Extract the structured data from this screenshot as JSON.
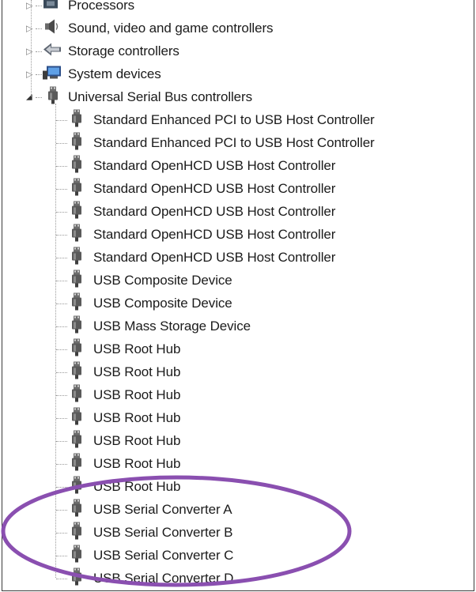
{
  "tree": {
    "categories": [
      {
        "label": "Processors",
        "icon": "processor-icon",
        "expanded": false
      },
      {
        "label": "Sound, video and game controllers",
        "icon": "speaker-icon",
        "expanded": false
      },
      {
        "label": "Storage controllers",
        "icon": "storage-controller-icon",
        "expanded": false
      },
      {
        "label": "System devices",
        "icon": "system-devices-icon",
        "expanded": false
      },
      {
        "label": "Universal Serial Bus controllers",
        "icon": "usb-plug-icon",
        "expanded": true
      }
    ],
    "usb_children": [
      {
        "label": "Standard Enhanced PCI to USB Host Controller",
        "icon": "usb-plug-icon"
      },
      {
        "label": "Standard Enhanced PCI to USB Host Controller",
        "icon": "usb-plug-icon"
      },
      {
        "label": "Standard OpenHCD USB Host Controller",
        "icon": "usb-plug-icon"
      },
      {
        "label": "Standard OpenHCD USB Host Controller",
        "icon": "usb-plug-icon"
      },
      {
        "label": "Standard OpenHCD USB Host Controller",
        "icon": "usb-plug-icon"
      },
      {
        "label": "Standard OpenHCD USB Host Controller",
        "icon": "usb-plug-icon"
      },
      {
        "label": "Standard OpenHCD USB Host Controller",
        "icon": "usb-plug-icon"
      },
      {
        "label": "USB Composite Device",
        "icon": "usb-plug-icon"
      },
      {
        "label": "USB Composite Device",
        "icon": "usb-plug-icon"
      },
      {
        "label": "USB Mass Storage Device",
        "icon": "usb-plug-icon"
      },
      {
        "label": "USB Root Hub",
        "icon": "usb-plug-icon"
      },
      {
        "label": "USB Root Hub",
        "icon": "usb-plug-icon"
      },
      {
        "label": "USB Root Hub",
        "icon": "usb-plug-icon"
      },
      {
        "label": "USB Root Hub",
        "icon": "usb-plug-icon"
      },
      {
        "label": "USB Root Hub",
        "icon": "usb-plug-icon"
      },
      {
        "label": "USB Root Hub",
        "icon": "usb-plug-icon"
      },
      {
        "label": "USB Root Hub",
        "icon": "usb-plug-icon"
      },
      {
        "label": "USB Serial Converter A",
        "icon": "usb-plug-icon"
      },
      {
        "label": "USB Serial Converter B",
        "icon": "usb-plug-icon"
      },
      {
        "label": "USB Serial Converter C",
        "icon": "usb-plug-icon"
      },
      {
        "label": "USB Serial Converter D",
        "icon": "usb-plug-icon"
      }
    ]
  },
  "colors": {
    "highlight_oval": "#8a4fb0",
    "tree_lines": "#9a9a9a",
    "text": "#1b1b1b"
  }
}
